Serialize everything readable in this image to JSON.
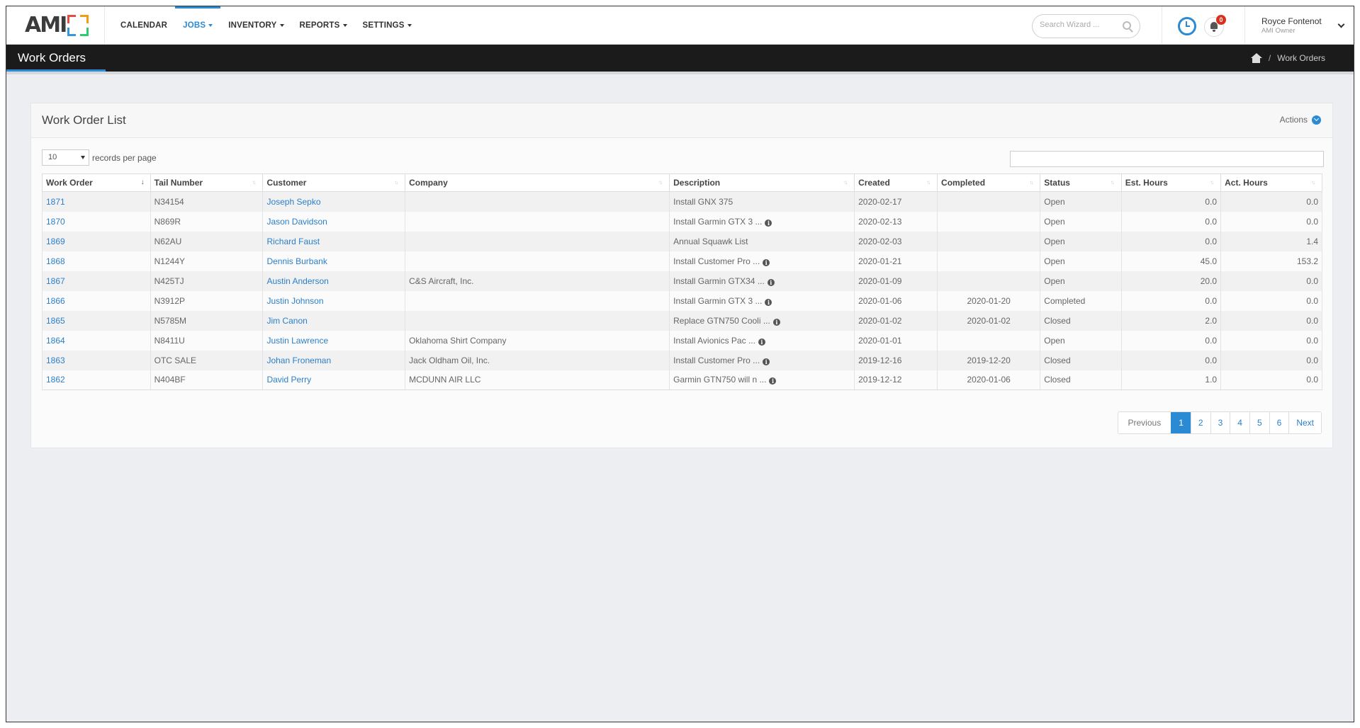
{
  "logo": {
    "text": "AMI"
  },
  "nav": [
    {
      "label": "CALENDAR",
      "active": false,
      "caret": false
    },
    {
      "label": "JOBS",
      "active": true,
      "caret": true
    },
    {
      "label": "INVENTORY",
      "active": false,
      "caret": true
    },
    {
      "label": "REPORTS",
      "active": false,
      "caret": true
    },
    {
      "label": "SETTINGS",
      "active": false,
      "caret": true
    }
  ],
  "search": {
    "placeholder": "Search Wizard ..."
  },
  "notifications": {
    "count": "0"
  },
  "user": {
    "name": "Royce Fontenot",
    "role": "AMI Owner"
  },
  "page": {
    "title": "Work Orders",
    "breadcrumb": "Work Orders"
  },
  "panel": {
    "title": "Work Order List",
    "actions_label": "Actions",
    "page_length": "10",
    "page_length_label": "records per page"
  },
  "table": {
    "columns": [
      "Work Order",
      "Tail Number",
      "Customer",
      "Company",
      "Description",
      "Created",
      "Completed",
      "Status",
      "Est. Hours",
      "Act. Hours"
    ],
    "rows": [
      {
        "wo": "1871",
        "tail": "N34154",
        "customer": "Joseph Sepko",
        "company": "",
        "description": "Install GNX 375",
        "info": false,
        "created": "2020-02-17",
        "completed": "",
        "status": "Open",
        "est": "0.0",
        "act": "0.0"
      },
      {
        "wo": "1870",
        "tail": "N869R",
        "customer": "Jason Davidson",
        "company": "",
        "description": "Install Garmin GTX 3 ...",
        "info": true,
        "created": "2020-02-13",
        "completed": "",
        "status": "Open",
        "est": "0.0",
        "act": "0.0"
      },
      {
        "wo": "1869",
        "tail": "N62AU",
        "customer": "Richard Faust",
        "company": "",
        "description": "Annual Squawk List",
        "info": false,
        "created": "2020-02-03",
        "completed": "",
        "status": "Open",
        "est": "0.0",
        "act": "1.4"
      },
      {
        "wo": "1868",
        "tail": "N1244Y",
        "customer": "Dennis Burbank",
        "company": "",
        "description": "Install Customer Pro ...",
        "info": true,
        "created": "2020-01-21",
        "completed": "",
        "status": "Open",
        "est": "45.0",
        "act": "153.2"
      },
      {
        "wo": "1867",
        "tail": "N425TJ",
        "customer": "Austin Anderson",
        "company": "C&S Aircraft, Inc.",
        "description": "Install Garmin GTX34 ...",
        "info": true,
        "created": "2020-01-09",
        "completed": "",
        "status": "Open",
        "est": "20.0",
        "act": "0.0"
      },
      {
        "wo": "1866",
        "tail": "N3912P",
        "customer": "Justin Johnson",
        "company": "",
        "description": "Install Garmin GTX 3 ...",
        "info": true,
        "created": "2020-01-06",
        "completed": "2020-01-20",
        "status": "Completed",
        "est": "0.0",
        "act": "0.0"
      },
      {
        "wo": "1865",
        "tail": "N5785M",
        "customer": "Jim Canon",
        "company": "",
        "description": "Replace GTN750 Cooli ...",
        "info": true,
        "created": "2020-01-02",
        "completed": "2020-01-02",
        "status": "Closed",
        "est": "2.0",
        "act": "0.0"
      },
      {
        "wo": "1864",
        "tail": "N8411U",
        "customer": "Justin Lawrence",
        "company": "Oklahoma Shirt Company",
        "description": "Install Avionics Pac ...",
        "info": true,
        "created": "2020-01-01",
        "completed": "",
        "status": "Open",
        "est": "0.0",
        "act": "0.0"
      },
      {
        "wo": "1863",
        "tail": "OTC SALE",
        "customer": "Johan Froneman",
        "company": "Jack Oldham Oil, Inc.",
        "description": "Install Customer Pro ...",
        "info": true,
        "created": "2019-12-16",
        "completed": "2019-12-20",
        "status": "Closed",
        "est": "0.0",
        "act": "0.0"
      },
      {
        "wo": "1862",
        "tail": "N404BF",
        "customer": "David Perry",
        "company": "MCDUNN AIR LLC",
        "description": "Garmin GTN750 will n ...",
        "info": true,
        "created": "2019-12-12",
        "completed": "2020-01-06",
        "status": "Closed",
        "est": "1.0",
        "act": "0.0"
      }
    ]
  },
  "pagination": {
    "previous": "Previous",
    "pages": [
      "1",
      "2",
      "3",
      "4",
      "5",
      "6"
    ],
    "active": "1",
    "next": "Next"
  },
  "colors": {
    "accent": "#2a8ad4",
    "header_bar": "#1b1b1b",
    "badge": "#d9301e"
  },
  "icons": {
    "home": "home-icon",
    "search": "search-icon",
    "clock": "clock-icon",
    "bell": "bell-icon",
    "info": "info-icon",
    "actions": "chevron-circle-down-icon"
  }
}
